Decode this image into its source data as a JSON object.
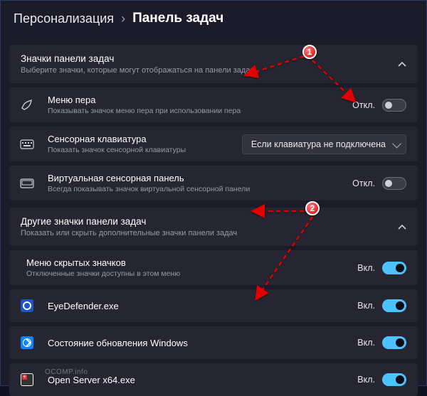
{
  "breadcrumb": {
    "parent": "Персонализация",
    "separator": "›",
    "current": "Панель задач"
  },
  "section1": {
    "title": "Значки панели задач",
    "sub": "Выберите значки, которые могут отображаться на панели задач",
    "rows": [
      {
        "icon": "pen-icon",
        "title": "Меню пера",
        "sub": "Показывать значок меню пера при использовании пера",
        "state_label": "Откл.",
        "state": "off"
      },
      {
        "icon": "touch-keyboard-icon",
        "title": "Сенсорная клавиатура",
        "sub": "Показать значок сенсорной клавиатуры",
        "dropdown": "Если клавиатура не подключена"
      },
      {
        "icon": "touchpad-icon",
        "title": "Виртуальная сенсорная панель",
        "sub": "Всегда показывать значок виртуальной сенсорной панели",
        "state_label": "Откл.",
        "state": "off"
      }
    ]
  },
  "section2": {
    "title": "Другие значки панели задач",
    "sub": "Показать или скрыть дополнительные значки панели задач",
    "rows": [
      {
        "title": "Меню скрытых значков",
        "sub": "Отключенные значки доступны в этом меню",
        "state_label": "Вкл.",
        "state": "on"
      },
      {
        "icon": "eye",
        "title": "EyeDefender.exe",
        "state_label": "Вкл.",
        "state": "on"
      },
      {
        "icon": "win",
        "title": "Состояние обновления Windows",
        "state_label": "Вкл.",
        "state": "on"
      },
      {
        "icon": "srv",
        "title": "Open Server x64.exe",
        "state_label": "Вкл.",
        "state": "on"
      }
    ]
  },
  "annotations": {
    "marker1": "1",
    "marker2": "2"
  },
  "watermark": "OCOMP.info"
}
